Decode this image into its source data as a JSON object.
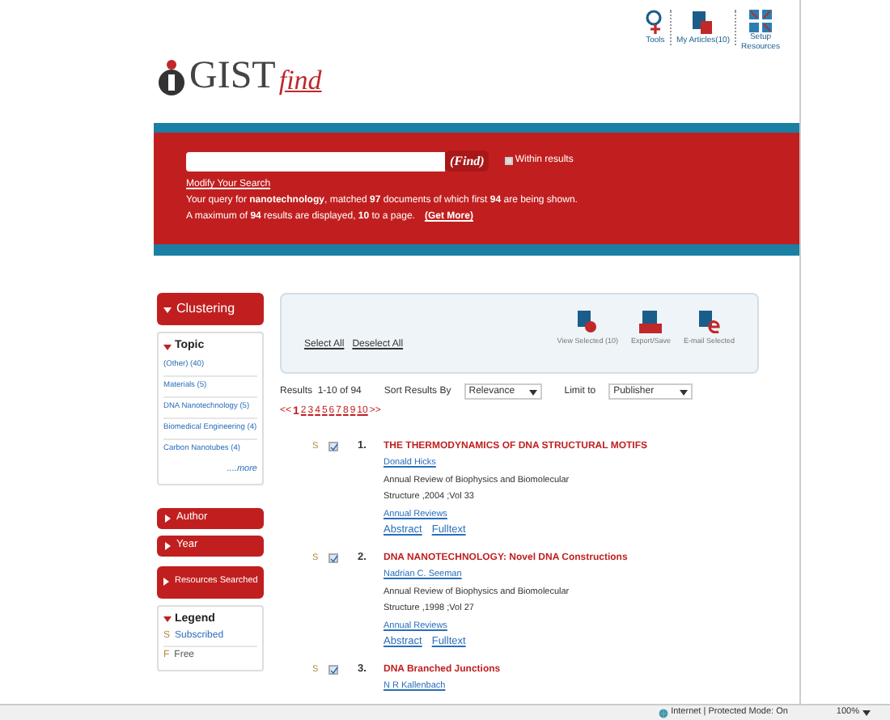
{
  "header": {
    "logo": {
      "brand": "GIST",
      "suffix": "find"
    },
    "tools": [
      {
        "kind": "tools",
        "label": "Tools"
      },
      {
        "kind": "articles",
        "label": "My Articles(10)"
      },
      {
        "kind": "setup",
        "label": "Setup Resources"
      }
    ]
  },
  "search": {
    "button": "(Find)",
    "within": {
      "label": "Within results",
      "checked": false
    },
    "modify_link": "Modify Your Search",
    "summary": [
      "Your query for **nanotechnology**, matched **97** documents of which first **94** are being shown.",
      "A maximum of **94** results are displayed, **10** to a page."
    ],
    "get_more": "(Get More)"
  },
  "sidebar": {
    "clustering": {
      "title": "Clustering",
      "expanded": true
    },
    "facet": {
      "title": "Topic",
      "expanded": true,
      "items": [
        "(Other) (40)",
        "Materials (5)",
        "DNA Nanotechnology (5)",
        "Biomedical Engineering (4)",
        "Carbon Nanotubes (4)"
      ],
      "more": "....more"
    },
    "sections": [
      {
        "title": "Author",
        "expanded": false
      },
      {
        "title": "Year",
        "expanded": false
      }
    ],
    "resources": "Resources Searched",
    "legend": {
      "title": "Legend",
      "expanded": true,
      "items": [
        {
          "badge": "S",
          "label": "Subscribed",
          "color": "#2a6ebb"
        },
        {
          "badge": "F",
          "label": "Free",
          "color": "#555555"
        }
      ]
    }
  },
  "toolbar": {
    "select_all": "Select All",
    "deselect_all": "Deselect All",
    "actions": [
      {
        "kind": "view",
        "label": "View Selected (10)"
      },
      {
        "kind": "export",
        "label": "Export/Save"
      },
      {
        "kind": "email",
        "label": "E-mail Selected"
      }
    ]
  },
  "results_bar": {
    "results": "Results  1-10 of 94",
    "sort_label": "Sort Results By",
    "sort_value": "Relevance",
    "limit_label": "Limit to",
    "limit_value": "Publisher"
  },
  "pagination": {
    "prev": "<<",
    "pages": [
      {
        "label": "1",
        "selected": true
      },
      {
        "label": "2",
        "selected": false
      },
      {
        "label": "3",
        "selected": false
      },
      {
        "label": "4",
        "selected": false
      },
      {
        "label": "5",
        "selected": false
      },
      {
        "label": "6",
        "selected": false
      },
      {
        "label": "7",
        "selected": false
      },
      {
        "label": "8",
        "selected": false
      },
      {
        "label": "9",
        "selected": false
      },
      {
        "label": "10",
        "selected": false
      }
    ],
    "next": ">>"
  },
  "results": [
    {
      "access": "S",
      "checked": true,
      "number": "1.",
      "title": "THE THERMODYNAMICS OF DNA STRUCTURAL MOTIFS",
      "author": "Donald Hicks",
      "source": [
        "Annual Review of Biophysics and Biomolecular",
        "Structure ,2004 ;Vol 33"
      ],
      "publisher": "Annual Reviews",
      "links": [
        "Abstract",
        "Fulltext"
      ]
    },
    {
      "access": "S",
      "checked": true,
      "number": "2.",
      "title": "DNA NANOTECHNOLOGY: Novel DNA Constructions",
      "author": "Nadrian C. Seeman",
      "source": [
        "Annual Review of Biophysics and Biomolecular",
        "Structure ,1998 ;Vol 27"
      ],
      "publisher": "Annual Reviews",
      "links": [
        "Abstract",
        "Fulltext"
      ]
    },
    {
      "access": "S",
      "checked": true,
      "number": "3.",
      "title": "DNA Branched Junctions",
      "author": "N R Kallenbach"
    }
  ],
  "status_bar": {
    "zone": "Internet | Protected Mode: On",
    "zoom": "100%"
  }
}
